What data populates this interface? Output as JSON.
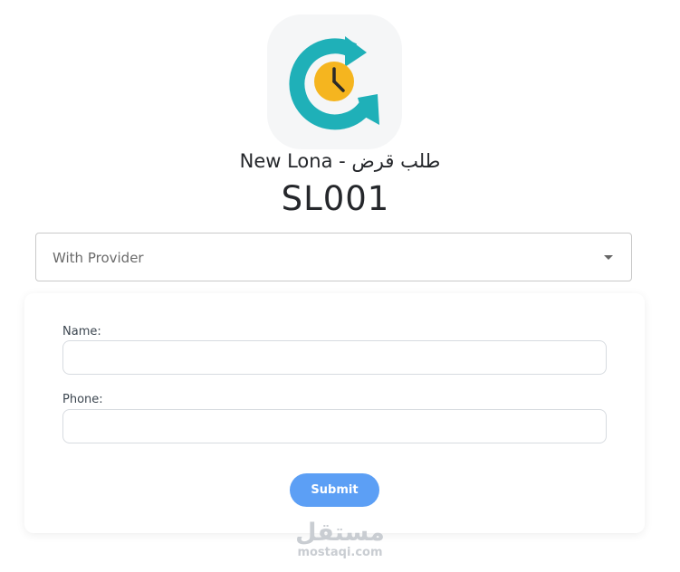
{
  "app": {
    "logo_icon": "clock-refresh-icon",
    "title": "New Lona - طلب قرض",
    "code": "SL001"
  },
  "provider_select": {
    "selected": "With Provider"
  },
  "form": {
    "name_label": "Name:",
    "name_value": "",
    "phone_label": "Phone:",
    "phone_value": "",
    "submit_label": "Submit"
  },
  "watermark": {
    "arabic": "مستقل",
    "latin": "mostaqi.com"
  },
  "colors": {
    "accent_teal": "#1fb0b8",
    "clock_yellow": "#f5b51f",
    "submit_blue": "#5c9ff5"
  }
}
